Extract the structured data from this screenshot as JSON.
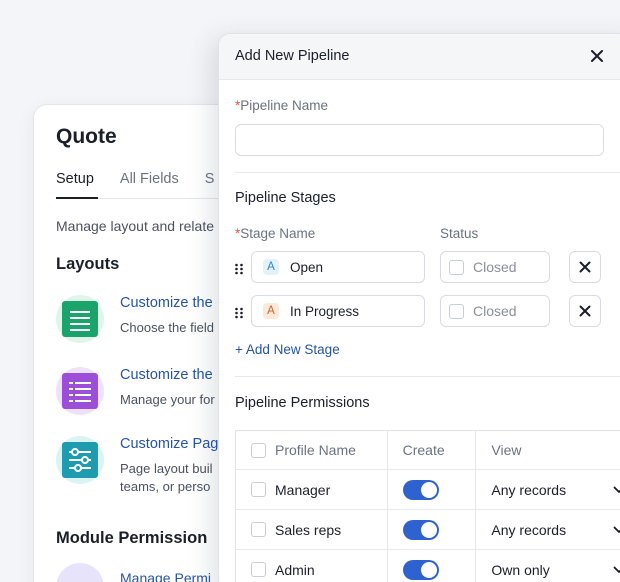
{
  "quote": {
    "title": "Quote",
    "tabs": [
      "Setup",
      "All Fields",
      "S"
    ],
    "description": "Manage layout and relate",
    "layouts_heading": "Layouts",
    "layouts": [
      {
        "title": "Customize the",
        "subtitle": "Choose the field",
        "icon": "list-layout-icon",
        "color": "#1aa36b"
      },
      {
        "title": "Customize the",
        "subtitle": "Manage your for",
        "icon": "form-layout-icon",
        "color": "#9b4ed8"
      },
      {
        "title": "Customize Pag",
        "subtitle": "Page layout buil",
        "subtitle2": "teams, or perso",
        "icon": "sliders-icon",
        "color": "#1f9bb0"
      }
    ],
    "module_heading": "Module Permission",
    "manage_link": "Manage Permi"
  },
  "modal": {
    "title": "Add New Pipeline",
    "pipeline_name_label": "Pipeline Name",
    "required_mark": "*",
    "pipeline_name_value": "",
    "stages_title": "Pipeline Stages",
    "stage_name_label": "Stage Name",
    "status_label": "Status",
    "stages": [
      {
        "badge": "A",
        "name": "Open",
        "status": "Closed",
        "badge_color": "#2a8bc8",
        "badge_bg": "#e3f1fa"
      },
      {
        "badge": "A",
        "name": "In Progress",
        "status": "Closed",
        "badge_color": "#c9652a",
        "badge_bg": "#fbe9dc"
      }
    ],
    "add_stage": "+ Add New Stage",
    "permissions_title": "Pipeline Permissions",
    "table_headers": [
      "Profile Name",
      "Create",
      "View"
    ],
    "rows": [
      {
        "profile": "Manager",
        "create": true,
        "view": "Any records"
      },
      {
        "profile": "Sales reps",
        "create": true,
        "view": "Any records"
      },
      {
        "profile": "Admin",
        "create": true,
        "view": "Own only"
      }
    ]
  }
}
